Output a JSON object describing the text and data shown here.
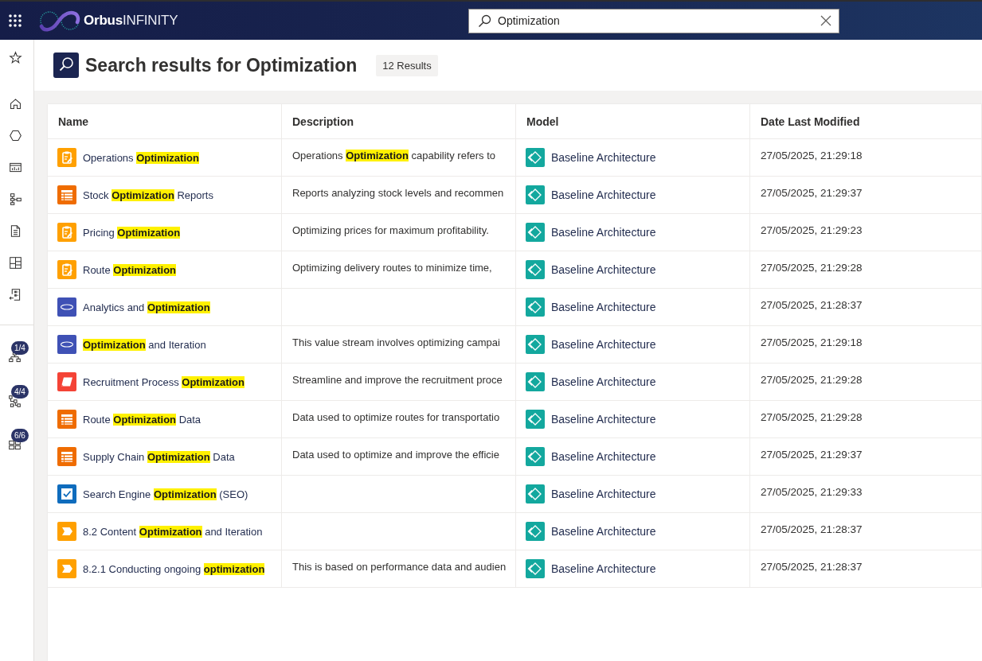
{
  "top_bar": {
    "logo_text": "**Orbus**INFINITY",
    "search": {
      "value": "Optimization"
    }
  },
  "sidebar": {
    "pinned_items": [
      {
        "badge": "1/4"
      },
      {
        "badge": "4/4"
      },
      {
        "badge": "6/6"
      }
    ]
  },
  "header": {
    "title": "Search results for Optimization",
    "result_count": "12 Results"
  },
  "table": {
    "columns": [
      "Name",
      "Description",
      "Model",
      "Date Last Modified"
    ],
    "rows": [
      {
        "kind": "clipboard",
        "name": "Operations **Optimization**",
        "description": "Operations **Optimization** capability refers to",
        "model": "Baseline Architecture",
        "date_last_modified": "27/05/2025, 21:29:18"
      },
      {
        "kind": "table",
        "name": "Stock **Optimization** Reports",
        "description": "Reports analyzing stock levels and recommen",
        "model": "Baseline Architecture",
        "date_last_modified": "27/05/2025, 21:29:37"
      },
      {
        "kind": "clipboard",
        "name": "Pricing **Optimization**",
        "description": "Optimizing prices for maximum profitability.",
        "model": "Baseline Architecture",
        "date_last_modified": "27/05/2025, 21:29:23"
      },
      {
        "kind": "clipboard",
        "name": "Route **Optimization**",
        "description": "Optimizing delivery routes to minimize time,",
        "model": "Baseline Architecture",
        "date_last_modified": "27/05/2025, 21:29:28"
      },
      {
        "kind": "ellipse",
        "name": "Analytics and **Optimization**",
        "model": "Baseline Architecture",
        "date_last_modified": "27/05/2025, 21:28:37"
      },
      {
        "kind": "ellipse",
        "name": "**Optimization** and Iteration",
        "description": "This value stream involves optimizing campai",
        "model": "Baseline Architecture",
        "date_last_modified": "27/05/2025, 21:29:18"
      },
      {
        "kind": "parallelogram",
        "name": "Recruitment Process **Optimization**",
        "description": "Streamline and improve the recruitment proce",
        "model": "Baseline Architecture",
        "date_last_modified": "27/05/2025, 21:29:28"
      },
      {
        "kind": "table",
        "name": "Route **Optimization** Data",
        "description": "Data used to optimize routes for transportatio",
        "model": "Baseline Architecture",
        "date_last_modified": "27/05/2025, 21:29:28"
      },
      {
        "kind": "table",
        "name": "Supply Chain **Optimization** Data",
        "description": "Data used to optimize and improve the efficie",
        "model": "Baseline Architecture",
        "date_last_modified": "27/05/2025, 21:29:37"
      },
      {
        "kind": "checkbox",
        "name": "Search Engine **Optimization** (SEO)",
        "model": "Baseline Architecture",
        "date_last_modified": "27/05/2025, 21:29:33"
      },
      {
        "kind": "chevron",
        "name": "8.2 Content **Optimization** and Iteration",
        "model": "Baseline Architecture",
        "date_last_modified": "27/05/2025, 21:28:37"
      },
      {
        "kind": "chevron",
        "name": "8.2.1 Conducting ongoing **optimization**",
        "description": "This is based on performance data and audien",
        "model": "Baseline Architecture",
        "date_last_modified": "27/05/2025, 21:28:37"
      }
    ]
  }
}
